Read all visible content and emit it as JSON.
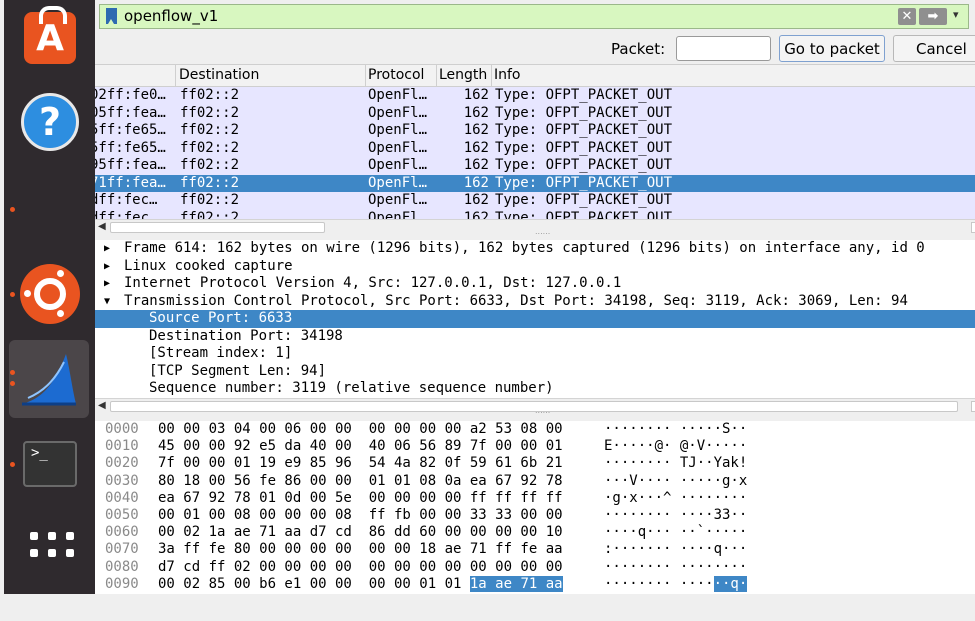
{
  "dock": {
    "apps": [
      "software-store",
      "help",
      "ubuntu",
      "wireshark",
      "terminal"
    ],
    "show_apps": "app-grid",
    "store_glyph": "A",
    "help_glyph": "?",
    "terminal_glyph": ">_"
  },
  "filter": {
    "value": "openflow_v1",
    "clear_glyph": "✕",
    "apply_glyph": "➡",
    "dropdown_glyph": "▾"
  },
  "goto": {
    "packet_label": "Packet:",
    "packet_value": "",
    "go_button": "Go to packet",
    "cancel_button": "Cancel"
  },
  "packet_list": {
    "columns": [
      "Destination",
      "Protocol",
      "Length",
      "Info"
    ],
    "rows": [
      {
        "src": "02ff:fe0…",
        "dst": "ff02::2",
        "proto": "OpenFl…",
        "len": "162",
        "info": "Type: OFPT_PACKET_OUT",
        "selected": false
      },
      {
        "src": "05ff:fea…",
        "dst": "ff02::2",
        "proto": "OpenFl…",
        "len": "162",
        "info": "Type: OFPT_PACKET_OUT",
        "selected": false
      },
      {
        "src": "5ff:fe65…",
        "dst": "ff02::2",
        "proto": "OpenFl…",
        "len": "162",
        "info": "Type: OFPT_PACKET_OUT",
        "selected": false
      },
      {
        "src": "5ff:fe65…",
        "dst": "ff02::2",
        "proto": "OpenFl…",
        "len": "162",
        "info": "Type: OFPT_PACKET_OUT",
        "selected": false
      },
      {
        "src": "95ff:fea…",
        "dst": "ff02::2",
        "proto": "OpenFl…",
        "len": "162",
        "info": "Type: OFPT_PACKET_OUT",
        "selected": false
      },
      {
        "src": "71ff:fea…",
        "dst": "ff02::2",
        "proto": "OpenFl…",
        "len": "162",
        "info": "Type: OFPT_PACKET_OUT",
        "selected": true
      },
      {
        "src": "dff:fec…",
        "dst": "ff02::2",
        "proto": "OpenFl…",
        "len": "162",
        "info": "Type: OFPT_PACKET_OUT",
        "selected": false
      },
      {
        "src": "dff:fec…",
        "dst": "ff02::2",
        "proto": "OpenFl…",
        "len": "162",
        "info": "Type: OFPT_PACKET_OUT",
        "selected": false
      }
    ]
  },
  "details": {
    "rows": [
      {
        "twisty": "▶",
        "text": "Frame 614: 162 bytes on wire (1296 bits), 162 bytes captured (1296 bits) on interface any, id 0",
        "child": false,
        "selected": false
      },
      {
        "twisty": "▶",
        "text": "Linux cooked capture",
        "child": false,
        "selected": false
      },
      {
        "twisty": "▶",
        "text": "Internet Protocol Version 4, Src: 127.0.0.1, Dst: 127.0.0.1",
        "child": false,
        "selected": false
      },
      {
        "twisty": "▼",
        "text": "Transmission Control Protocol, Src Port: 6633, Dst Port: 34198, Seq: 3119, Ack: 3069, Len: 94",
        "child": false,
        "selected": false
      },
      {
        "twisty": "",
        "text": "Source Port: 6633",
        "child": true,
        "selected": true
      },
      {
        "twisty": "",
        "text": "Destination Port: 34198",
        "child": true,
        "selected": false
      },
      {
        "twisty": "",
        "text": "[Stream index: 1]",
        "child": true,
        "selected": false
      },
      {
        "twisty": "",
        "text": "[TCP Segment Len: 94]",
        "child": true,
        "selected": false
      },
      {
        "twisty": "",
        "text": "Sequence number: 3119    (relative sequence number)",
        "child": true,
        "selected": false
      }
    ]
  },
  "bytes": {
    "rows": [
      {
        "off": "0000",
        "hex": "00 00 03 04 00 06 00 00  00 00 00 00 a2 53 08 00",
        "hl_hex": "",
        "ascii": "········ ·····S··",
        "hl_ascii": ""
      },
      {
        "off": "0010",
        "hex": "45 00 00 92 e5 da 40 00  40 06 56 89 7f 00 00 01",
        "hl_hex": "",
        "ascii": "E·····@· @·V·····",
        "hl_ascii": ""
      },
      {
        "off": "0020",
        "hex": "7f 00 00 01 19 e9 85 96  54 4a 82 0f 59 61 6b 21",
        "hl_hex": "",
        "ascii": "········ TJ··Yak!",
        "hl_ascii": ""
      },
      {
        "off": "0030",
        "hex": "80 18 00 56 fe 86 00 00  01 01 08 0a ea 67 92 78",
        "hl_hex": "",
        "ascii": "···V···· ·····g·x",
        "hl_ascii": ""
      },
      {
        "off": "0040",
        "hex": "ea 67 92 78 01 0d 00 5e  00 00 00 00 ff ff ff ff",
        "hl_hex": "",
        "ascii": "·g·x···^ ········",
        "hl_ascii": ""
      },
      {
        "off": "0050",
        "hex": "00 01 00 08 00 00 00 08  ff fb 00 00 33 33 00 00",
        "hl_hex": "",
        "ascii": "········ ····33··",
        "hl_ascii": ""
      },
      {
        "off": "0060",
        "hex": "00 02 1a ae 71 aa d7 cd  86 dd 60 00 00 00 00 10",
        "hl_hex": "",
        "ascii": "····q··· ··`·····",
        "hl_ascii": ""
      },
      {
        "off": "0070",
        "hex": "3a ff fe 80 00 00 00 00  00 00 18 ae 71 ff fe aa",
        "hl_hex": "",
        "ascii": ":······· ····q···",
        "hl_ascii": ""
      },
      {
        "off": "0080",
        "hex": "d7 cd ff 02 00 00 00 00  00 00 00 00 00 00 00 00",
        "hl_hex": "",
        "ascii": "········ ········",
        "hl_ascii": ""
      },
      {
        "off": "0090",
        "hex": "00 02 85 00 b6 e1 00 00  00 00 01 01 ",
        "hl_hex": "1a ae 71 aa",
        "ascii": "········ ····",
        "hl_ascii": "··q·"
      }
    ]
  },
  "colors": {
    "filter_valid_bg": "#d8f7c0",
    "row_bg": "#e7e6ff",
    "selection": "#3e87c6",
    "dock_bg": "#2f2a2e",
    "ubuntu_orange": "#e95420"
  }
}
